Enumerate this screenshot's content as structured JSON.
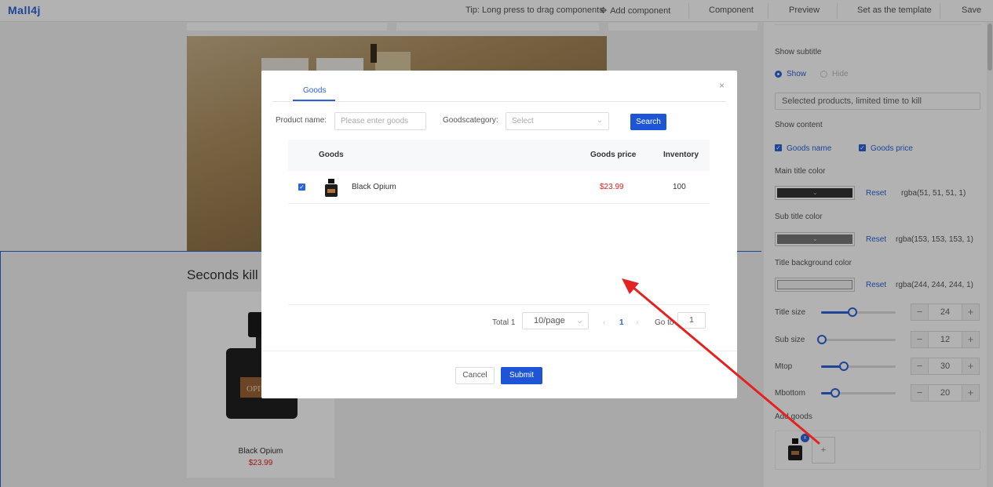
{
  "app": {
    "logo": "Mall4j"
  },
  "topbar": {
    "tip": "Tip: Long press to drag components",
    "add_component": "Add component",
    "component": "Component",
    "preview": "Preview",
    "set_template": "Set as the template",
    "save": "Save"
  },
  "canvas": {
    "section_title": "Seconds kill",
    "product": {
      "name": "Black Opium",
      "price": "$23.99"
    }
  },
  "sidebar": {
    "show_subtitle_label": "Show subtitle",
    "show_opt": "Show",
    "hide_opt": "Hide",
    "subtitle_value": "Selected products, limited time to kill",
    "show_content_label": "Show content",
    "goods_name_opt": "Goods name",
    "goods_price_opt": "Goods price",
    "main_title_color_label": "Main title color",
    "main_title_color": "#333333",
    "main_title_rgba": "rgba(51, 51, 51, 1)",
    "sub_title_color_label": "Sub title color",
    "sub_title_color": "#999999",
    "sub_title_rgba": "rgba(153, 153, 153, 1)",
    "title_bg_color_label": "Title background color",
    "title_bg_color": "#f4f4f4",
    "title_bg_rgba": "rgba(244, 244, 244, 1)",
    "reset": "Reset",
    "title_size_label": "Title size",
    "title_size": "24",
    "sub_size_label": "Sub size",
    "sub_size": "12",
    "mtop_label": "Mtop",
    "mtop": "30",
    "mbottom_label": "Mbottom",
    "mbottom": "20",
    "add_goods_label": "Add goods",
    "add_button": "+",
    "remove_badge": "x"
  },
  "modal": {
    "tab": "Goods",
    "close": "×",
    "product_name_label": "Product name:",
    "product_name_placeholder": "Please enter goods",
    "category_label": "Goodscategory:",
    "category_placeholder": "Select",
    "search_button": "Search",
    "columns": {
      "goods": "Goods",
      "price": "Goods price",
      "inventory": "Inventory"
    },
    "rows": [
      {
        "name": "Black Opium",
        "price": "$23.99",
        "inventory": "100"
      }
    ],
    "pagination": {
      "total": "Total 1",
      "page_size": "10/page",
      "current": "1",
      "goto_label": "Go to",
      "goto_value": "1"
    },
    "cancel": "Cancel",
    "submit": "Submit"
  },
  "colors": {
    "accent": "#1e55d6",
    "price": "#e02020",
    "annotation_arrow": "#e52222"
  }
}
